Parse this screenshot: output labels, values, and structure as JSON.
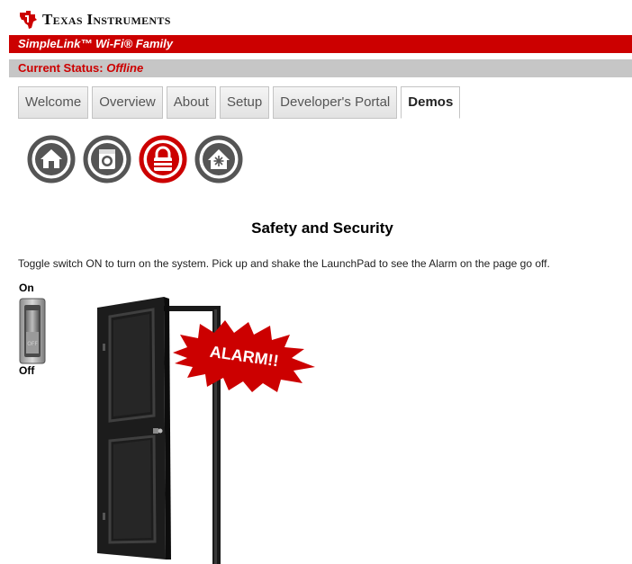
{
  "header": {
    "brand_name": "Texas Instruments",
    "product_name": "SimpleLink™ Wi-Fi® Family",
    "status_label": "Current Status:",
    "status_value": "Offline"
  },
  "tabs": [
    {
      "label": "Welcome",
      "active": false
    },
    {
      "label": "Overview",
      "active": false
    },
    {
      "label": "About",
      "active": false
    },
    {
      "label": "Setup",
      "active": false
    },
    {
      "label": "Developer's Portal",
      "active": false
    },
    {
      "label": "Demos",
      "active": true
    }
  ],
  "demo_icons": [
    {
      "icon": "home-icon",
      "color": "#555555",
      "selected": false
    },
    {
      "icon": "washer-icon",
      "color": "#555555",
      "selected": false
    },
    {
      "icon": "lock-icon",
      "color": "#cc0000",
      "selected": true
    },
    {
      "icon": "home-climate-icon",
      "color": "#555555",
      "selected": false
    }
  ],
  "main": {
    "title": "Safety and Security",
    "instructions": "Toggle switch ON to turn on the system. Pick up and shake the LaunchPad to see the Alarm on the page go off.",
    "switch": {
      "on_label": "On",
      "off_label": "Off",
      "knob_label": "OFF",
      "state": "off"
    },
    "alarm_text": "ALARM!!"
  },
  "colors": {
    "brand_red": "#cc0000",
    "status_gray": "#c6c6c6",
    "icon_gray": "#555555"
  }
}
